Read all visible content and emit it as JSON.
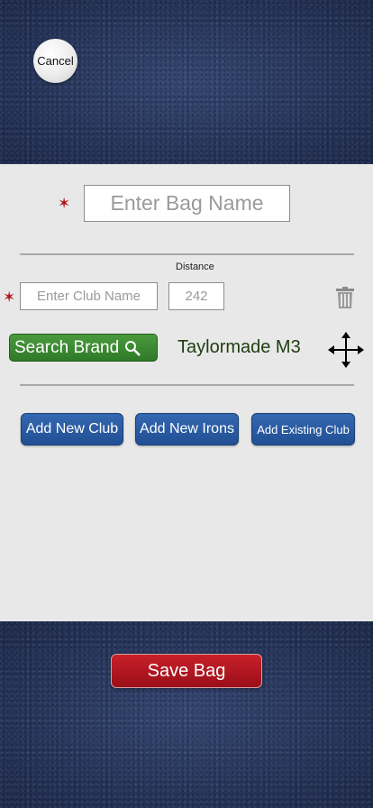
{
  "header": {
    "cancel_label": "Cancel"
  },
  "bag": {
    "name_placeholder": "Enter Bag Name",
    "required_mark": "✶"
  },
  "club": {
    "distance_label": "Distance",
    "name_placeholder": "Enter Club Name",
    "distance_value": "242",
    "required_mark": "✶",
    "search_brand_label": "Search Brand",
    "brand_value": "Taylormade M3"
  },
  "actions": {
    "add_new_club": "Add New Club",
    "add_new_irons": "Add New Irons",
    "add_existing_club": "Add Existing Club"
  },
  "footer": {
    "save_label": "Save Bag"
  },
  "colors": {
    "search_green": "#3a8a32",
    "action_blue": "#2a5ba3",
    "save_red": "#b3141b",
    "required_red": "#b3141b"
  },
  "icons": [
    "trash-icon",
    "move-icon",
    "magnifier-icon"
  ]
}
